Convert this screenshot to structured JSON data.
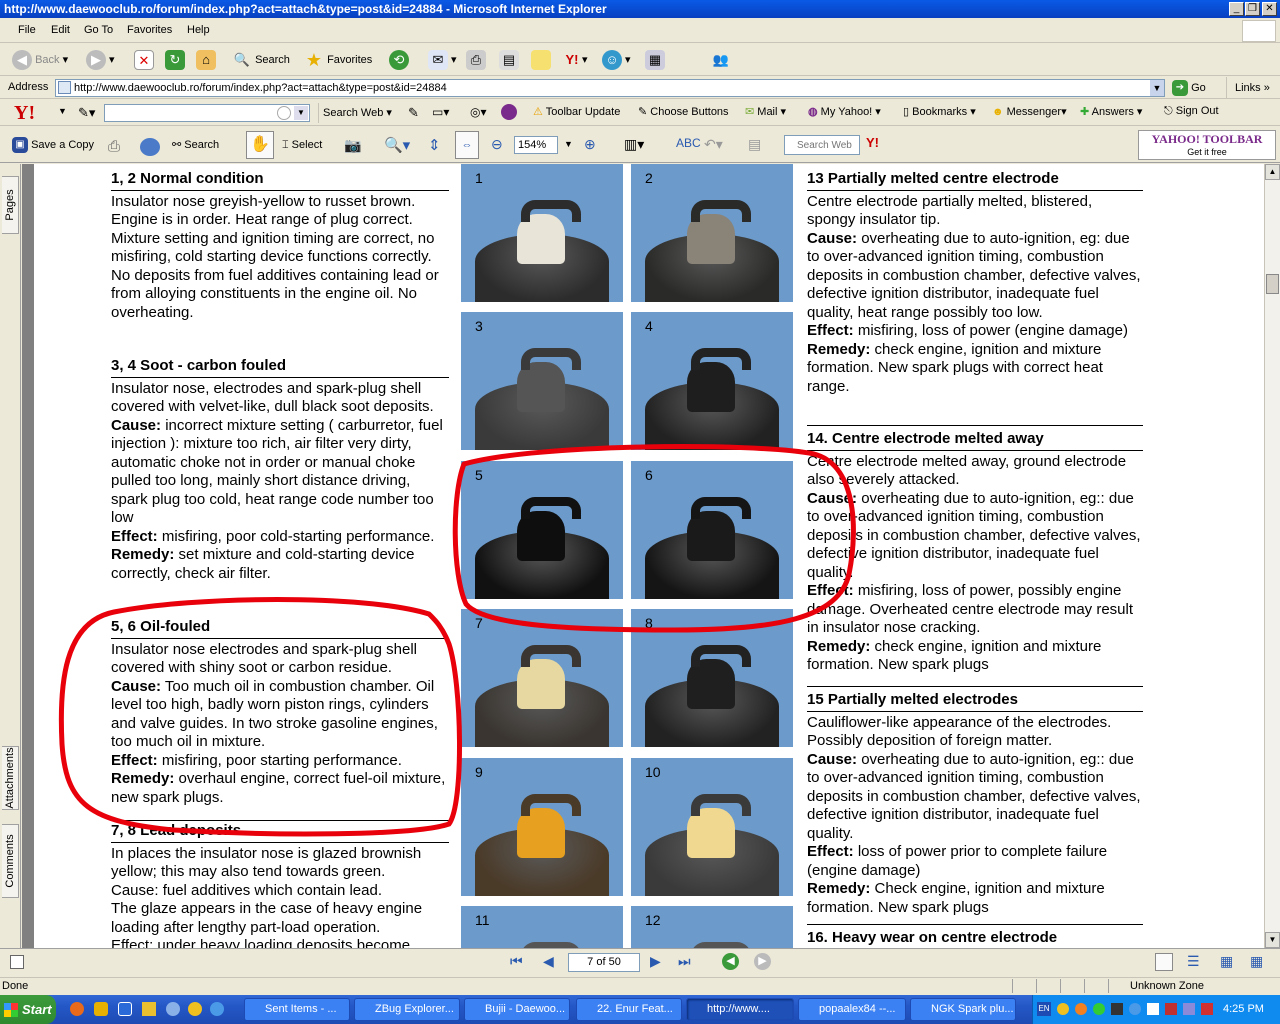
{
  "window": {
    "title": "http://www.daewooclub.ro/forum/index.php?act=attach&type=post&id=24884 - Microsoft Internet Explorer",
    "min": "_",
    "max": "❐",
    "close": "✕"
  },
  "menu": [
    "File",
    "Edit",
    "Go To",
    "Favorites",
    "Help"
  ],
  "toolbar": {
    "back": "Back",
    "search": "Search",
    "favorites": "Favorites"
  },
  "address": {
    "label": "Address",
    "url": "http://www.daewooclub.ro/forum/index.php?act=attach&type=post&id=24884",
    "go": "Go",
    "links": "Links"
  },
  "yahoo_toolbar": {
    "logo": "Y!",
    "search_web": "Search Web",
    "toolbar_update": "Toolbar Update",
    "choose_buttons": "Choose Buttons",
    "mail": "Mail",
    "my_yahoo": "My Yahoo!",
    "bookmarks": "Bookmarks",
    "messenger": "Messenger",
    "answers": "Answers",
    "sign_out": "Sign Out"
  },
  "acrobat": {
    "save_copy": "Save a Copy",
    "search": "Search",
    "select": "Select",
    "zoom": "154%",
    "search_web_placeholder": "Search Web",
    "yahoo_banner_title": "YAHOO! TOOLBAR",
    "yahoo_banner_sub": "Get it free"
  },
  "side_tabs": {
    "pages": "Pages",
    "attachments": "Attachments",
    "comments": "Comments"
  },
  "document": {
    "left": [
      {
        "heading": "1, 2  Normal condition",
        "body": "Insulator nose greyish-yellow to russet brown. Engine is in order. Heat range of plug correct. Mixture setting and ignition timing are correct, no misfiring, cold starting device functions correctly.\nNo deposits from fuel additives containing lead or from alloying constituents in the engine oil. No overheating."
      },
      {
        "heading": "3, 4  Soot - carbon fouled",
        "intro": "Insulator nose, electrodes and spark-plug shell covered with velvet-like, dull black soot deposits.",
        "cause_label": "Cause:",
        "cause": " incorrect mixture setting  ( carburretor, fuel injection ): mixture too  rich, air filter very dirty, automatic choke not in order or manual choke pulled too long, mainly short distance driving, spark plug too cold, heat range code number too low",
        "effect_label": "Effect:",
        "effect": " misfiring, poor cold-starting performance.",
        "remedy_label": "Remedy:",
        "remedy": " set mixture and cold-starting device correctly, check air filter."
      },
      {
        "heading": "5, 6  Oil-fouled",
        "intro": "Insulator nose electrodes and spark-plug shell covered with shiny soot or carbon residue.",
        "cause_label": "Cause:",
        "cause": " Too much oil in combustion chamber. Oil level too high, badly worn piston rings, cylinders and valve guides. In two stroke gasoline engines, too much oil in mixture.",
        "effect_label": "Effect:",
        "effect": " misfiring, poor starting performance.",
        "remedy_label": "Remedy:",
        "remedy": " overhaul engine, correct fuel-oil mixture, new spark plugs."
      },
      {
        "heading": "7, 8  Lead deposits",
        "body": "In places the insulator nose is glazed brownish yellow; this may also tend towards green.\nCause: fuel additives which contain lead.\nThe glaze appears in the case of heavy engine loading after lengthy part-load operation.\nEffect: under heavy loading deposits become"
      }
    ],
    "right": [
      {
        "heading": "13  Partially melted centre electrode",
        "intro": "Centre electrode partially melted, blistered, spongy insulator tip.",
        "cause_label": "Cause:",
        "cause": " overheating due to auto-ignition, eg: due to over-advanced ignition timing, combustion deposits in combustion chamber, defective valves, defective ignition distributor, inadequate fuel quality, heat range possibly too low.",
        "effect_label": "Effect:",
        "effect": " misfiring, loss of power (engine damage)",
        "remedy_label": "Remedy:",
        "remedy": " check engine, ignition and mixture formation. New spark plugs with correct heat range."
      },
      {
        "heading": "14.  Centre electrode melted away",
        "intro": "Centre electrode melted away, ground electrode also severely attacked.",
        "cause_label": "Cause:",
        "cause": " overheating due to auto-ignition, eg:: due to over-advanced ignition timing, combustion deposits in combustion chamber, defective valves, defective ignition distributor, inadequate fuel quality.",
        "effect_label": "Effect:",
        "effect": " misfiring, loss of power, possibly engine damage. Overheated centre electrode may result in insulator nose cracking.",
        "remedy_label": "Remedy:",
        "remedy": " check engine, ignition and mixture formation. New spark plugs"
      },
      {
        "heading": "15  Partially melted electrodes",
        "intro": " Cauliflower-like appearance of the electrodes. Possibly deposition of foreign matter.",
        "cause_label": "Cause:",
        "cause": " overheating due to auto-ignition, eg:: due to over-advanced ignition timing, combustion deposits in combustion chamber, defective valves, defective ignition distributor, inadequate fuel quality.",
        "effect_label": "Effect:",
        "effect": " loss of power prior to complete failure (engine damage)",
        "remedy_label": "Remedy:",
        "remedy": " Check engine, ignition and mixture formation. New spark plugs"
      },
      {
        "heading": "16.  Heavy wear on centre electrode"
      }
    ],
    "photos": [
      {
        "num": "1",
        "ins": "#e8e4d8",
        "plug": "#2c2c2c"
      },
      {
        "num": "2",
        "ins": "#8a8378",
        "plug": "#2a2a28"
      },
      {
        "num": "3",
        "ins": "#555555",
        "plug": "#3a3a3a"
      },
      {
        "num": "4",
        "ins": "#1e1e1e",
        "plug": "#222222"
      },
      {
        "num": "5",
        "ins": "#0e0e0e",
        "plug": "#111111"
      },
      {
        "num": "6",
        "ins": "#1a1a1a",
        "plug": "#151515"
      },
      {
        "num": "7",
        "ins": "#e6d8a0",
        "plug": "#3a3530"
      },
      {
        "num": "8",
        "ins": "#1f1f1f",
        "plug": "#222222"
      },
      {
        "num": "9",
        "ins": "#e8a020",
        "plug": "#4a3a28"
      },
      {
        "num": "10",
        "ins": "#f0d890",
        "plug": "#3a3a3a"
      },
      {
        "num": "11",
        "ins": "#cccccc",
        "plug": "#555555"
      },
      {
        "num": "12",
        "ins": "#c8b890",
        "plug": "#555555"
      }
    ],
    "highlight_color": "#e8000b"
  },
  "nav": {
    "page": "7 of 50"
  },
  "status": {
    "left": "Done",
    "zone": "Unknown Zone"
  },
  "taskbar": {
    "start": "Start",
    "tasks": [
      "Sent Items - ...",
      "ZBug Explorer...",
      "Bujii - Daewoo...",
      "22. Enur Feat...",
      "http://www....",
      "popaalex84 --...",
      "NGK Spark plu..."
    ],
    "lang": "EN",
    "clock": "4:25 PM"
  }
}
